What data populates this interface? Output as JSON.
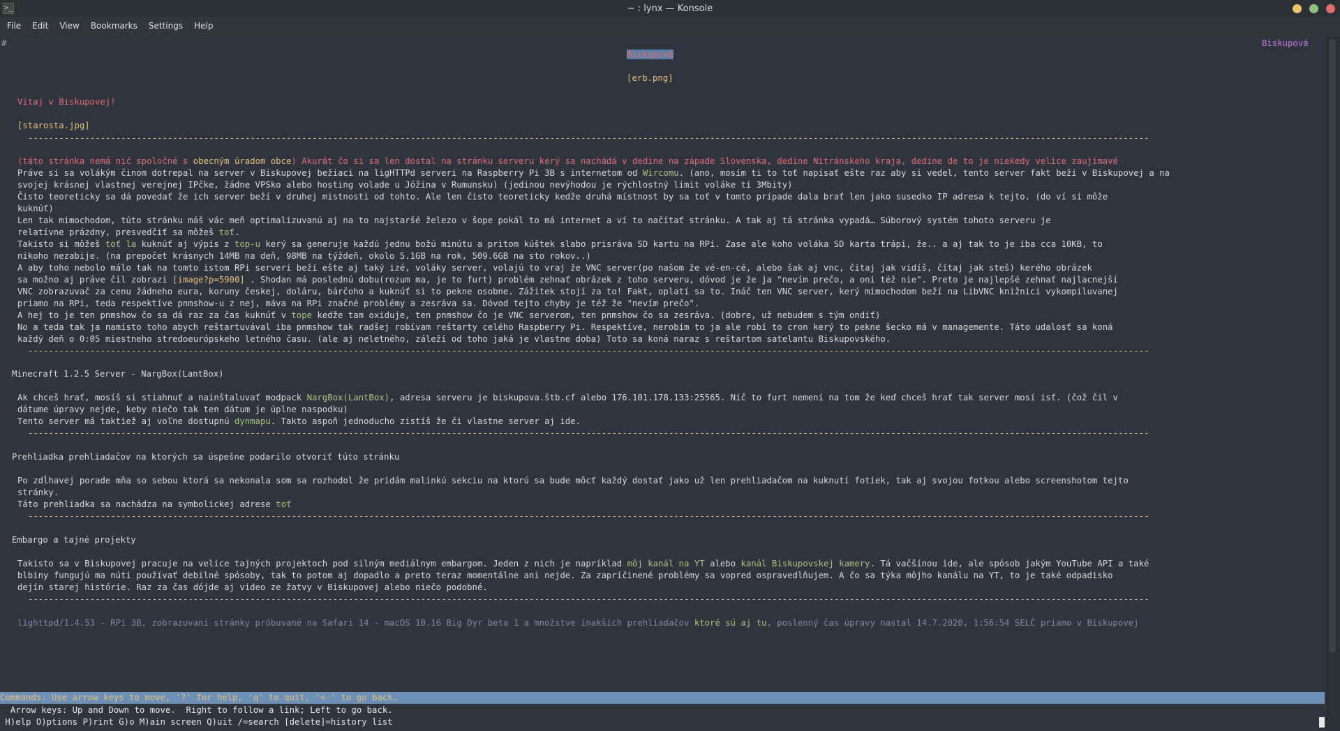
{
  "window": {
    "title": "~ : lynx — Konsole"
  },
  "menubar": {
    "items": [
      "File",
      "Edit",
      "View",
      "Bookmarks",
      "Settings",
      "Help"
    ]
  },
  "page": {
    "corner_mark": "#",
    "top_right_title": "Biskupová",
    "center_title": "Biskupová",
    "erb": "[erb.png]",
    "welcome": "Vitaj v Biskupovej!",
    "starosta": "[starosta.jpg]",
    "intro": {
      "prefix": "(táto stránka nemá nič spoločné s ",
      "link_obecny": "obecným úradom obce",
      "rest": ") Akurát čo si sa len dostal na stránku serveru kerý sa nachádá v dedine na západe Slovenska, dedine Nitránskeho kraja, dedine de to je niekedy velice zaujímavé"
    },
    "p1": {
      "a": "Práve si sa volákým činom dotrepal na server v Biskupovej bežiaci na ligHTTPd serveri na Raspberry Pi 3B s internetom od ",
      "link": "Wircomu",
      "b": ". (ano, mosím ti to toť napísať ešte raz aby si vedel, tento server fakt beží v Biskupovej a na",
      "c": "svojej krásnej vlastnej verejnej IPčke, žádne VPSko alebo hosting volade u Jóžina v Rumunsku) (jedinou nevýhodou je rýchlostný limit voláke tí 3Mbity)"
    },
    "p2": {
      "a": "Čisto teoreticky sa dá povedať že ich server beží v druhej mistnosti od tohto. Ale len čisto teoreticky kedže druhá místnost by sa toť v tomto prípade dala brať len jako susedko IP adresa k tejto. (do ví si môže",
      "b": "kuknúť)"
    },
    "p3": {
      "a": "Len tak mimochodom, túto stránku máš vác meň optimalizuvanú aj na to najstaršé železo v šope pokál to má internet a ví to načítať stránku. A tak aj tá stránka vypadá… Súborový systém tohoto serveru je",
      "b1": "relatívne prázdny, presvedčiť sa môžeš ",
      "b_link": "toť",
      "b2": "."
    },
    "p4": {
      "a1": "Takisto si môžeš ",
      "link1": "toť la",
      "a2": " kuknúť aj výpis z ",
      "link2": "top-u",
      "a3": " kerý sa generuje každú jednu božú minútu a pritom kúštek slabo prisráva SD kartu na RPi. Zase ale koho voláka SD karta trápi, že.. a aj tak to je iba cca 10KB, to",
      "b": "nikoho nezabije. (na prepočet krásnych 14MB na deň, 98MB na týždeň, okolo 5.1GB na rok, 509.6GB na sto rokov..)"
    },
    "p5": {
      "a": "A aby toho nebolo málo tak na tomto istom RPi serveri beží ešte aj taký izé, voláky server, volajú to vraj že VNC server(po našom že vé-en-cé, alebo šak aj vnc, čítaj jak vidíš, čítaj jak steš) kerého obrázek",
      "b1": "sa možno aj práve číl zobrazí ",
      "b_img": "[image?p=5900]",
      "b2": " . Shodan má poslednú dobu(rozum ma, je to furt) problém zehnať obrázek z toho serveru, dóvod je že ja \"nevím prečo, a oni též nie\". Preto je najlepšé zehnať najlacnejší",
      "c": "VNC zobrazuvač za cenu žádneho eura, koruny českej, doláru, bárčoho a kuknúť si to pekne osobne. Zážitek stojí za to! Fakt, oplatí sa to. Ináč ten VNC server, kerý mimochodom beží na LibVNC knižnici vykompiluvanej",
      "d": "priamo na RPi, teda respektíve pnmshow-u z nej, máva na RPi značné problémy a zesráva sa. Dóvod tejto chyby je též že \"nevím prečo\"."
    },
    "p6": {
      "a1": "A hej to je ten pnmshow čo sa dá raz za čas kuknúť v ",
      "link": "tope",
      "a2": " kedže tam oxiduje, ten pnmshow čo je VNC serverom, ten pnmshow čo sa zesráva. (dobre, už nebudem s tým ondiť)"
    },
    "p7": {
      "a": "No a teda tak ja namísto toho abych reštartuvával iba pnmshow tak radšej robívam reštarty celého Raspberry Pi. Respektíve, nerobím to ja ale robí to cron kerý to pekne šecko má v managemente. Táto udalosť sa koná",
      "b": "každý deň o 0:05 miestneho stredoeurópskeho letného času. (ale aj neletného, záleží od toho jaká je vlastne doba) Toto sa koná naraz s reštartom satelantu Biskupovského."
    },
    "minecraft": {
      "heading": "Minecraft 1.2.5 Server - NargBox(LantBox)",
      "a1": "Ak chceš hrať, mosíš si stiahnuť a nainštaluvať modpack ",
      "a_link": "NargBox(LantBox)",
      "a2": ", adresa serveru je biskupova.štb.cf alebo 176.101.178.133:25565. Nič to furt nemení na tom že keď chceš hrať tak server mosí isť. (čož čil v",
      "b": "dátume úpravy nejde, keby niečo tak ten dátum je úplne naspodku)",
      "c1": "Tento server má taktiež aj voľne dostupnú ",
      "c_link": "dynmapu",
      "c2": ". Takto aspoň jednoducho zistíš že či vlastne server aj ide."
    },
    "browsers": {
      "heading": "Prehliadka prehliadačov na ktorých sa úspešne podarilo otvoriť túto stránku",
      "a": "Po zdĺhavej porade mňa so sebou ktorá sa nekonala som sa rozhodol že pridám malinkú sekciu na ktorú sa bude môcť každý dostať jako už len prehliadačom na kuknutí fotiek, tak aj svojou fotkou alebo screenshotom tejto",
      "b": "stránky.",
      "c1": "Táto prehliadka sa nachádza na symbolickej adrese ",
      "c_link": "toť"
    },
    "embargo": {
      "heading": "Embargo a tajné projekty",
      "a1": "Takisto sa v Biskupovej pracuje na velice tajných projektoch pod silným mediálnym embargom. Jeden z nich je napríklad ",
      "a_link1": "môj kanál na YT",
      "a2": " alebo ",
      "a_link2": "kanál Biskupovskej kamery",
      "a3": ". Tá vačšínou ide, ale spósob jakým YouTube API a také",
      "b": "blbiny fungujú ma núti používať debilné spósoby, tak to potom aj dopadlo a preto teraz momentálne ani nejde. Za zapríčinené problémy sa vopred ospravedlňujem. A čo sa týka môjho kanálu na YT, to je také odpadisko",
      "c": "dejín starej histórie. Raz za čas dójde aj video ze žatvy v Biskupovej alebo niečo podobné."
    },
    "footer": {
      "a": "lighttpd/1.4.53 - RPi 3B, zobrazuvaní stránky próbuvané na Safari 14 - macOS 10.16 Big Dyr beta 1 a množstve inakších prehliadačov ",
      "link": "ktoré sú aj tu",
      "b": ", poslenný čas úpravy nastal 14.7.2020, 1:56:54 SELČ priamo v Biskupovej"
    },
    "rule": "-------------------------------------------------------------------------------------------------------------------------------------------------------------------------------------------------------------------------"
  },
  "status": {
    "commands": "Commands: Use arrow keys to move, '?' for help, 'q' to quit, '<-' to go back.",
    "arrows": "  Arrow keys: Up and Down to move.  Right to follow a link; Left to go back.",
    "keys": " H)elp O)ptions P)rint G)o M)ain screen Q)uit /=search [delete]=history list"
  }
}
